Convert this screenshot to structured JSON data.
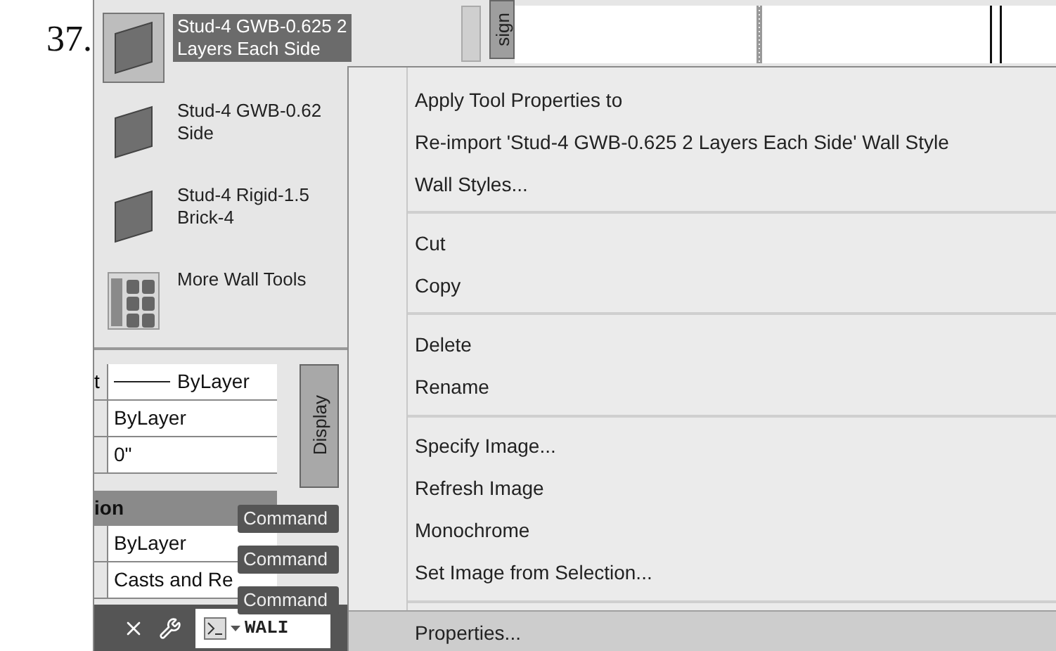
{
  "step": "37.",
  "palette": {
    "tools": [
      {
        "kind": "wall",
        "lines": [
          "Stud-4 GWB-0.625 2",
          "Layers Each Side"
        ],
        "selected": true
      },
      {
        "kind": "wall",
        "lines": [
          "Stud-4 GWB-0.62",
          "Side"
        ],
        "selected": false
      },
      {
        "kind": "wall",
        "lines": [
          "Stud-4 Rigid-1.5",
          "Brick-4"
        ],
        "selected": false
      },
      {
        "kind": "more",
        "lines": [
          "More Wall Tools"
        ],
        "selected": false
      }
    ]
  },
  "side_tab": "sign",
  "properties": {
    "rows": [
      {
        "kind": "line",
        "label": "t",
        "value": "ByLayer"
      },
      {
        "kind": "plain",
        "value": "ByLayer"
      },
      {
        "kind": "plain",
        "value": "0\""
      }
    ],
    "section": "ion",
    "section_rows": [
      {
        "kind": "plain",
        "value": "ByLayer"
      },
      {
        "kind": "plain",
        "value": "Casts and Re"
      }
    ]
  },
  "display_tab": "Display",
  "command_lines": [
    "Command",
    "Command",
    "Command"
  ],
  "command_bar": {
    "input": "WALI"
  },
  "context_menu": {
    "groups": [
      [
        {
          "label": "Apply Tool Properties to",
          "selected": false
        },
        {
          "label": "Re-import 'Stud-4 GWB-0.625 2 Layers Each Side' Wall Style",
          "selected": false
        },
        {
          "label": "Wall Styles...",
          "selected": false
        }
      ],
      [
        {
          "label": "Cut",
          "selected": false
        },
        {
          "label": "Copy",
          "selected": false
        }
      ],
      [
        {
          "label": "Delete",
          "selected": false
        },
        {
          "label": "Rename",
          "selected": false
        }
      ],
      [
        {
          "label": "Specify Image...",
          "selected": false
        },
        {
          "label": "Refresh Image",
          "selected": false
        },
        {
          "label": "Monochrome",
          "selected": false
        },
        {
          "label": "Set Image from Selection...",
          "selected": false
        }
      ],
      [
        {
          "label": "Properties...",
          "selected": true
        }
      ]
    ]
  }
}
